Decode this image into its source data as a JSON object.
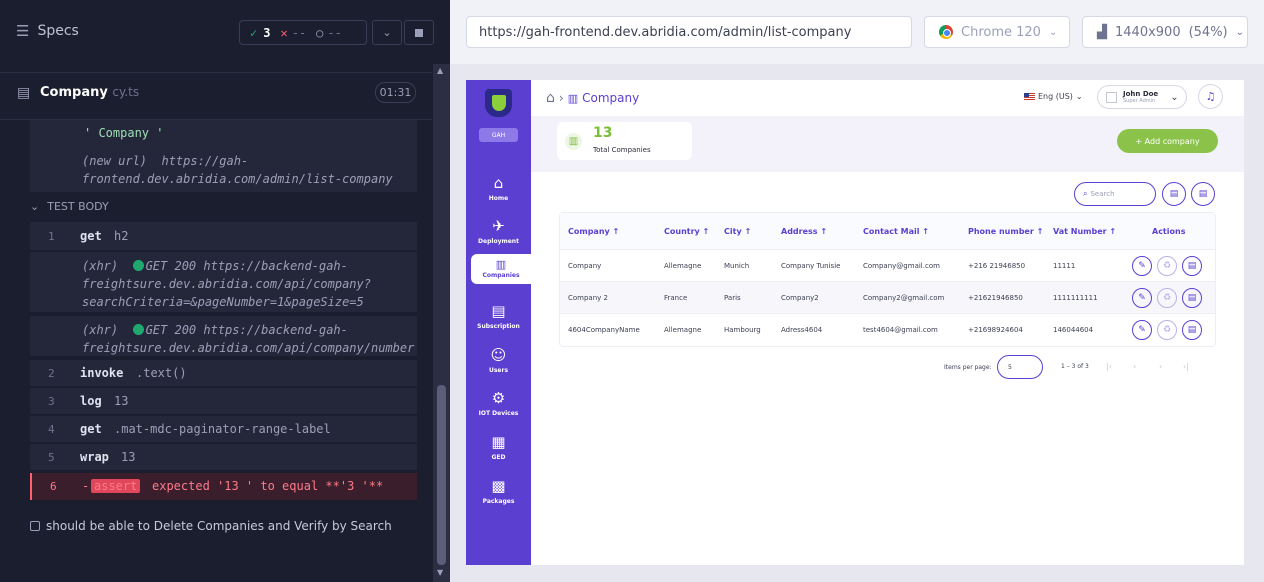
{
  "runner": {
    "specs_label": "Specs",
    "passed": "3",
    "failed": "--",
    "pending": "--",
    "file_name": "Company",
    "file_ext": "cy.ts",
    "duration": "01:31",
    "prev_cmd_text": "' Company '",
    "prev_cmd_url": "(new url)  https://gah-\nfrontend.dev.abridia.com/admin/list-company",
    "test_body_label": "TEST BODY",
    "commands": [
      {
        "num": "1",
        "name": "get",
        "msg": "h2"
      },
      {
        "xhr": "(xhr)  ",
        "status": "GET 200 https://backend-gah-\nfreightsure.dev.abridia.com/api/company?\nsearchCriteria=&pageNumber=1&pageSize=5"
      },
      {
        "xhr": "(xhr)  ",
        "status": "GET 200 https://backend-gah-\nfreightsure.dev.abridia.com/api/company/number"
      },
      {
        "num": "2",
        "name": "invoke",
        "msg": ".text()"
      },
      {
        "num": "3",
        "name": "log",
        "msg": "13"
      },
      {
        "num": "4",
        "name": "get",
        "msg": ".mat-mdc-paginator-range-label"
      },
      {
        "num": "5",
        "name": "wrap",
        "msg": "13"
      },
      {
        "num": "6",
        "dash": "-",
        "badge": "assert",
        "msg": "expected '13 ' to equal **'3 '**"
      }
    ],
    "next_test": "should be able to Delete Companies and Verify by Search"
  },
  "browser": {
    "url": "https://gah-frontend.dev.abridia.com/admin/list-company",
    "browser_name": "Chrome 120",
    "viewport": "1440x900",
    "zoom": "(54%)"
  },
  "app": {
    "gah_badge": "GAH",
    "nav": [
      {
        "label": "Home",
        "icon": "⌂"
      },
      {
        "label": "Deployment",
        "icon": "✈"
      },
      {
        "label": "Companies",
        "icon": "▥"
      },
      {
        "label": "Subscription",
        "icon": "▤"
      },
      {
        "label": "Users",
        "icon": "☺"
      },
      {
        "label": "IOT Devices",
        "icon": "⚙"
      },
      {
        "label": "GED",
        "icon": "▦"
      },
      {
        "label": "Packages",
        "icon": "▩"
      }
    ],
    "breadcrumb": "Company",
    "language": "Eng (US)",
    "user_name": "John Doe",
    "user_role": "Super Admin",
    "total_count": "13",
    "total_label": "Total Companies",
    "add_button": "+ Add company",
    "search_placeholder": "Search",
    "columns": [
      "Company ↑",
      "Country ↑",
      "City ↑",
      "Address ↑",
      "Contact Mail ↑",
      "Phone number ↑",
      "Vat Number ↑",
      "Actions"
    ],
    "rows": [
      [
        "Company",
        "Allemagne",
        "Munich",
        "Company Tunisie",
        "Company@gmail.com",
        "+216 21946850",
        "11111"
      ],
      [
        "Company 2",
        "France",
        "Paris",
        "Company2",
        "Company2@gmail.com",
        "+21621946850",
        "1111111111"
      ],
      [
        "4604CompanyName",
        "Allemagne",
        "Hambourg",
        "Adress4604",
        "test4604@gmail.com",
        "+21698924604",
        "146044604"
      ]
    ],
    "items_per_page_label": "Items per page:",
    "page_size": "5",
    "range_label": "1 – 3 of 3"
  }
}
